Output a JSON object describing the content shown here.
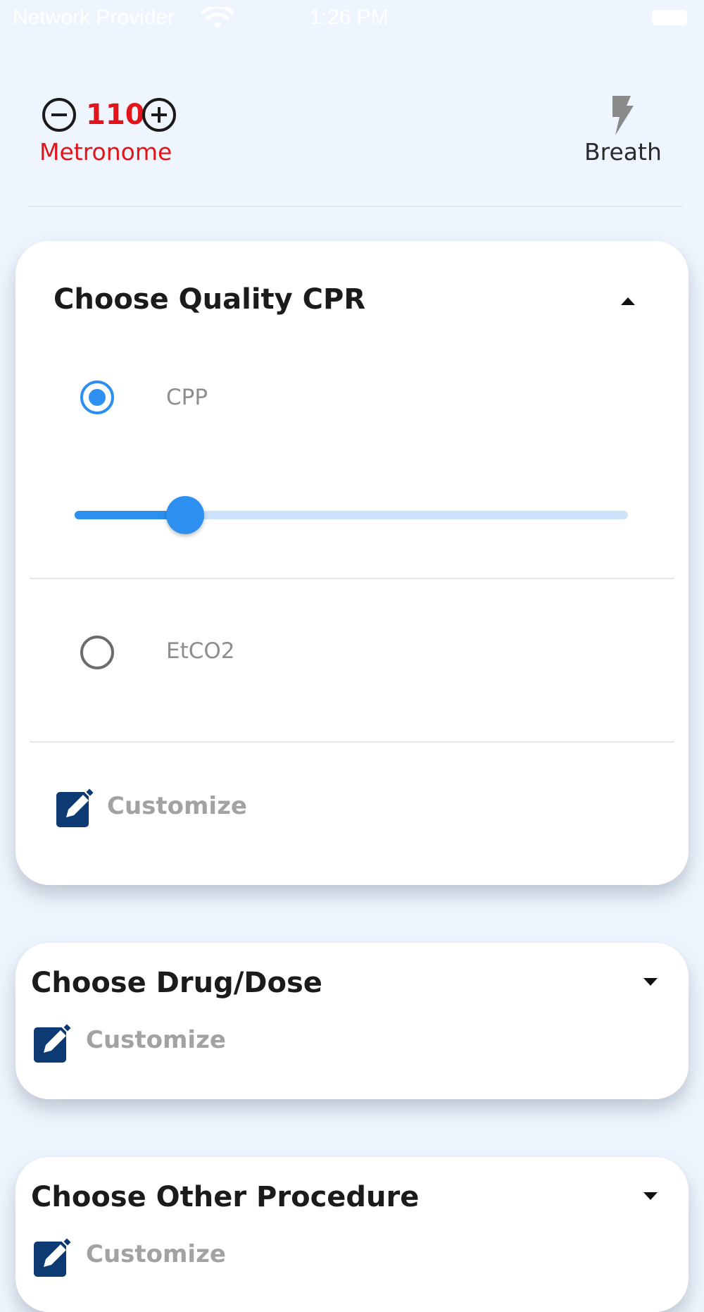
{
  "status_bar": {
    "carrier": "Network Provider",
    "time": "1:26 PM"
  },
  "header": {
    "bpm": "110",
    "metronome_label": "Metronome",
    "breath_label": "Breath",
    "colors": {
      "accent_red": "#e3151a"
    }
  },
  "sections": [
    {
      "title": "Choose Quality CPR",
      "expanded": true,
      "options": [
        {
          "label": "CPP",
          "selected": true,
          "slider_value_fraction": 0.2
        },
        {
          "label": "EtCO2",
          "selected": false
        }
      ],
      "customize_label": "Customize"
    },
    {
      "title": "Choose Drug/Dose",
      "expanded": false,
      "customize_label": "Customize"
    },
    {
      "title": "Choose Other Procedure",
      "expanded": false,
      "customize_label": "Customize"
    }
  ],
  "colors": {
    "primary_blue": "#2d8ff0",
    "slider_track": "#cde3fb",
    "edit_icon_navy": "#0d3a73",
    "background": "#eef5fe"
  }
}
